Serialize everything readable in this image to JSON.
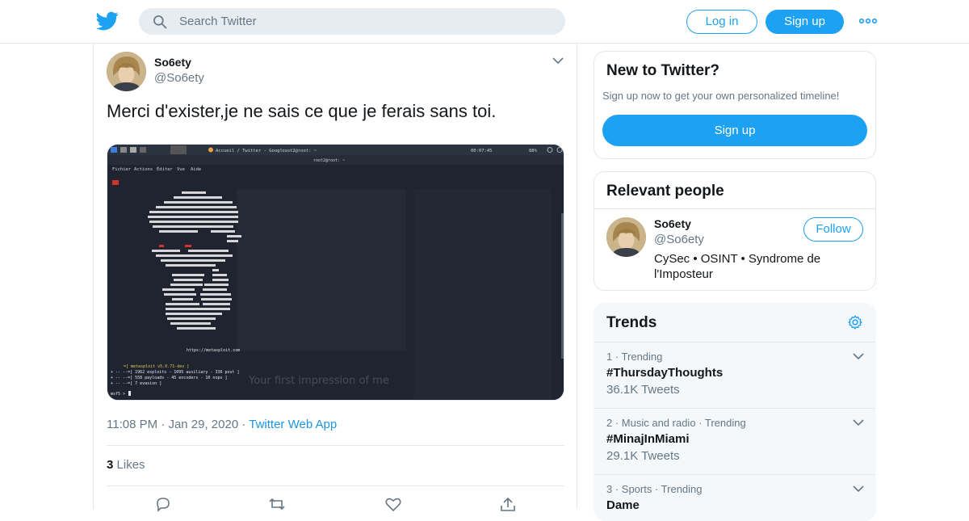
{
  "header": {
    "search_placeholder": "Search Twitter",
    "login_label": "Log in",
    "signup_label": "Sign up",
    "brand_color": "#1da1f2"
  },
  "tweet": {
    "author_name": "So6ety",
    "author_handle": "@So6ety",
    "text": "Merci d'exister,je ne sais ce que je ferais sans toi.",
    "time": "11:08 PM",
    "date": "Jan 29, 2020",
    "source": "Twitter Web App",
    "likes_count": "3",
    "likes_label": "Likes",
    "media": {
      "tab_title": "Accueil / Twitter - Googl...",
      "terminal_title": "root2@root: ~",
      "clock": "00:07:45",
      "battery": "88%",
      "menu": [
        "Fichier",
        "Actions",
        "Éditer",
        "Vue",
        "Aide"
      ],
      "terminal_lines": [
        "=[ metasploit v5.0.71-dev                          ]",
        "+ -- --=[ 1962 exploits - 1095 auxiliary - 336 post       ]",
        "+ -- --=[ 558 payloads - 45 encoders - 10 nops            ]",
        "+ -- --=[ 7 evasion                                       ]"
      ],
      "url_line": "https://metasploit.com",
      "prompt": "msf5 >",
      "ghost_text": "Your first impression of me"
    }
  },
  "sidebar": {
    "new_to_twitter": {
      "title": "New to Twitter?",
      "subtitle": "Sign up now to get your own personalized timeline!",
      "signup_label": "Sign up"
    },
    "relevant_people": {
      "title": "Relevant people",
      "name": "So6ety",
      "handle": "@So6ety",
      "follow_label": "Follow",
      "bio_line1": "CySec • OSINT • Syndrome de",
      "bio_line2": "l'Imposteur"
    },
    "trends": {
      "title": "Trends",
      "items": [
        {
          "context": "1 · Trending",
          "name": "#ThursdayThoughts",
          "count": "36.1K Tweets"
        },
        {
          "context": "2 · Music and radio · Trending",
          "name": "#MinajInMiami",
          "count": "29.1K Tweets"
        },
        {
          "context": "3 · Sports · Trending",
          "name": "Dame",
          "count": ""
        }
      ]
    }
  }
}
